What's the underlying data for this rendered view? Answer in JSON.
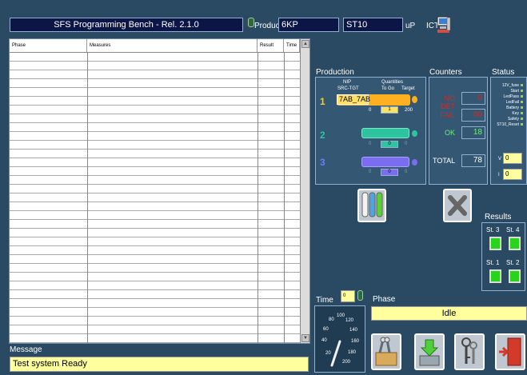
{
  "header": {
    "title": "SFS Programming Bench - Rel. 2.1.0",
    "product_label": "Product",
    "product_value": "6KP",
    "up_value": "ST10",
    "up_label": "uP",
    "ict_label": "ICT"
  },
  "table": {
    "columns": [
      "Phase",
      "Measures",
      "Result",
      "Time"
    ],
    "scroll_up": "▲",
    "scroll_down": "▼"
  },
  "message": {
    "label": "Message",
    "text": "Test system Ready"
  },
  "production": {
    "title": "Production",
    "col_nip": "NIP",
    "col_quantities": "Quantities",
    "col_src": "SRC-TGT",
    "col_togo": "To Go",
    "col_target": "Target",
    "slots": [
      {
        "num": "1",
        "code": "7AB_7AB",
        "from": "0",
        "togo": "1",
        "target": "200",
        "color": "#ffb020"
      },
      {
        "num": "2",
        "code": "",
        "from": "0",
        "togo": "0",
        "target": "0",
        "color": "#2ec4a0"
      },
      {
        "num": "3",
        "code": "",
        "from": "0",
        "togo": "0",
        "target": "0",
        "color": "#7c6cf0"
      }
    ]
  },
  "counters": {
    "title": "Counters",
    "no_det_label": "NO DET",
    "no_det_value": "0",
    "fail_label": "FAIL",
    "fail_value": "60",
    "ok_label": "OK",
    "ok_value": "18",
    "total_label": "TOTAL",
    "total_value": "78"
  },
  "status": {
    "title": "Status",
    "items": [
      "12V_fuse",
      "Start",
      "LedPass",
      "LedFail",
      "Battery",
      "Key",
      "Safety",
      "ST10_Reset"
    ],
    "v_label": "V",
    "v_value": "0",
    "i_label": "I",
    "i_value": "0"
  },
  "results": {
    "title": "Results",
    "st3": "St. 3",
    "st4": "St. 4",
    "st1": "St. 1",
    "st2": "St. 2"
  },
  "time": {
    "label": "Time",
    "value": "0",
    "ticks": [
      "20",
      "40",
      "60",
      "80",
      "100",
      "120",
      "140",
      "160",
      "180",
      "200"
    ]
  },
  "phase": {
    "label": "Phase",
    "value": "Idle"
  }
}
